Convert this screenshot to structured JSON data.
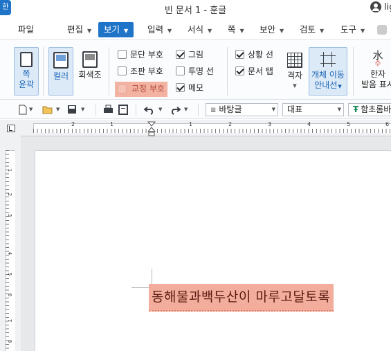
{
  "titlebar": {
    "app_logo": "한",
    "title": "빈 문서 1 - 훈글",
    "user_name": "lig"
  },
  "menubar": {
    "items": [
      {
        "label": "파일",
        "caret": false
      },
      {
        "label": "편집",
        "caret": true
      },
      {
        "label": "보기",
        "caret": true,
        "active": true
      },
      {
        "label": "입력",
        "caret": true
      },
      {
        "label": "서식",
        "caret": true
      },
      {
        "label": "쪽",
        "caret": true
      },
      {
        "label": "보안",
        "caret": true
      },
      {
        "label": "검토",
        "caret": true
      },
      {
        "label": "도구",
        "caret": true
      }
    ]
  },
  "ribbon": {
    "page_outline": {
      "line1": "쪽",
      "line2": "윤곽"
    },
    "color": "컬러",
    "grayscale": "회색조",
    "checks": {
      "paragraph_mark": {
        "label": "문단 부호",
        "checked": false
      },
      "formatting_mark": {
        "label": "조판 부호",
        "checked": false
      },
      "proof_mark": {
        "label": "교정 부호",
        "checked": false
      },
      "picture": {
        "label": "그림",
        "checked": true
      },
      "transparent_line": {
        "label": "투명 선",
        "checked": false
      },
      "memo": {
        "label": "메모",
        "checked": true
      },
      "status_line": {
        "label": "상황 선",
        "checked": true
      },
      "doc_tab": {
        "label": "문서 탭",
        "checked": true
      }
    },
    "grid": "격자",
    "object_move": {
      "line1": "개체 이동",
      "line2": "안내선"
    },
    "hanja": {
      "glyph": "水",
      "sub": "수",
      "line1": "한자",
      "line2": "발음 표시"
    }
  },
  "toolbar": {
    "style_combo": "바탕글",
    "font_combo": "대표",
    "font_name": "함초롬바"
  },
  "ruler": {
    "h_numbers": [
      "2",
      "1",
      "1",
      "2",
      "3",
      "4",
      "5",
      "6"
    ],
    "v_numbers": [
      "1",
      "2",
      "3",
      "4",
      "5",
      "6",
      "7",
      "8"
    ]
  },
  "document": {
    "text": "동해물과백두산이 마루고달토록"
  },
  "colors": {
    "accent": "#1f74c8",
    "highlight": "#f2ad9c",
    "ribbon_selected": "#dce9f7"
  }
}
